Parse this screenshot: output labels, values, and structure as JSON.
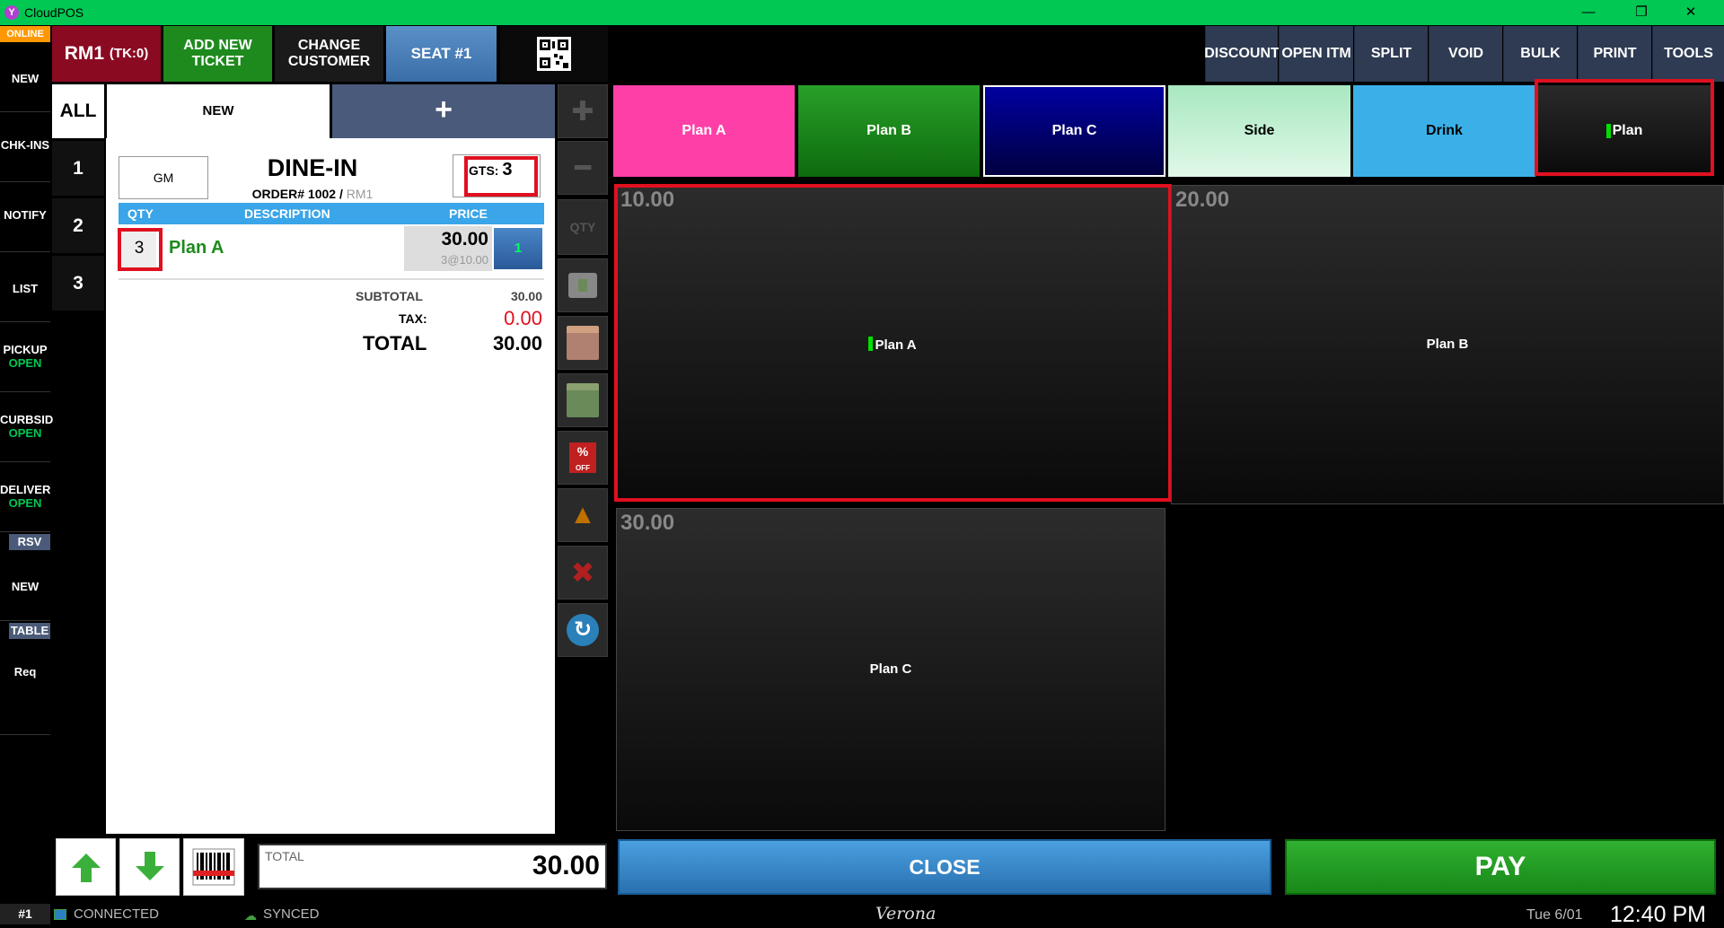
{
  "window": {
    "title": "CloudPOS",
    "app_icon": "Y",
    "minimize": "—",
    "restore": "❐",
    "close": "✕"
  },
  "sidebar": {
    "online": "ONLINE",
    "items": [
      {
        "label": "NEW",
        "sub": ""
      },
      {
        "label": "CHK-INS",
        "sub": ""
      },
      {
        "label": "NOTIFY",
        "sub": ""
      },
      {
        "label": "LIST",
        "sub": ""
      },
      {
        "label": "PICKUP",
        "sub": "OPEN"
      },
      {
        "label": "CURBSID",
        "sub": "OPEN"
      },
      {
        "label": "DELIVER",
        "sub": "OPEN"
      }
    ],
    "rsv_label": "RSV",
    "rsv_new": "NEW",
    "table_label": "TABLE",
    "table_req": "Req"
  },
  "header": {
    "room": "RM1",
    "tk": "(TK:0)",
    "add_new_ticket": "ADD NEW\nTICKET",
    "change_customer": "CHANGE\nCUSTOMER",
    "seat": "SEAT #1"
  },
  "tickets": {
    "all": "ALL",
    "tab_new": "NEW",
    "add": "+",
    "seats": [
      "1",
      "2",
      "3"
    ]
  },
  "order": {
    "gm": "GM",
    "type": "DINE-IN",
    "order_no_label": "ORDER#",
    "order_no": "1002",
    "room": "RM1",
    "gts_label": "GTS:",
    "gts_value": "3",
    "columns": {
      "qty": "QTY",
      "description": "DESCRIPTION",
      "price": "PRICE"
    },
    "items": [
      {
        "qty": "3",
        "description": "Plan A",
        "price": "30.00",
        "unit": "3@10.00",
        "seat": "1"
      }
    ],
    "subtotal_label": "SUBTOTAL",
    "subtotal": "30.00",
    "tax_label": "TAX:",
    "tax": "0.00",
    "total_label": "TOTAL",
    "total": "30.00"
  },
  "tools": [
    "plus",
    "minus",
    "QTY",
    "add-item",
    "memo",
    "modifier",
    "discount",
    "fire",
    "void",
    "refresh"
  ],
  "tool_labels": {
    "qty": "QTY",
    "pct": "%",
    "off": "OFF"
  },
  "bottom": {
    "total_label": "TOTAL",
    "total": "30.00",
    "close": "CLOSE",
    "pay": "PAY"
  },
  "top_actions": [
    "DISCOUNT",
    "OPEN ITM",
    "SPLIT",
    "VOID",
    "BULK",
    "PRINT",
    "TOOLS"
  ],
  "categories": [
    {
      "label": "Plan A",
      "bg": "#ff3fa8",
      "fg": "#ffffff"
    },
    {
      "label": "Plan B",
      "bg": "#1e8c1e",
      "fg": "#ffffff"
    },
    {
      "label": "Plan C",
      "bg": "#000088",
      "fg": "#ffffff"
    },
    {
      "label": "Side",
      "bg": "#bff0d0",
      "fg": "#000000"
    },
    {
      "label": "Drink",
      "bg": "#3bb0e8",
      "fg": "#000000"
    },
    {
      "label": "Plan",
      "bg": "#141414",
      "fg": "#ffffff"
    }
  ],
  "menu_items": [
    {
      "price": "10.00",
      "label": "Plan A"
    },
    {
      "price": "20.00",
      "label": "Plan B"
    },
    {
      "price": "30.00",
      "label": "Plan C"
    }
  ],
  "status": {
    "terminal": "#1",
    "connected": "CONNECTED",
    "synced": "SYNCED",
    "location": "Verona",
    "date": "Tue 6/01",
    "time": "12:40 PM"
  }
}
